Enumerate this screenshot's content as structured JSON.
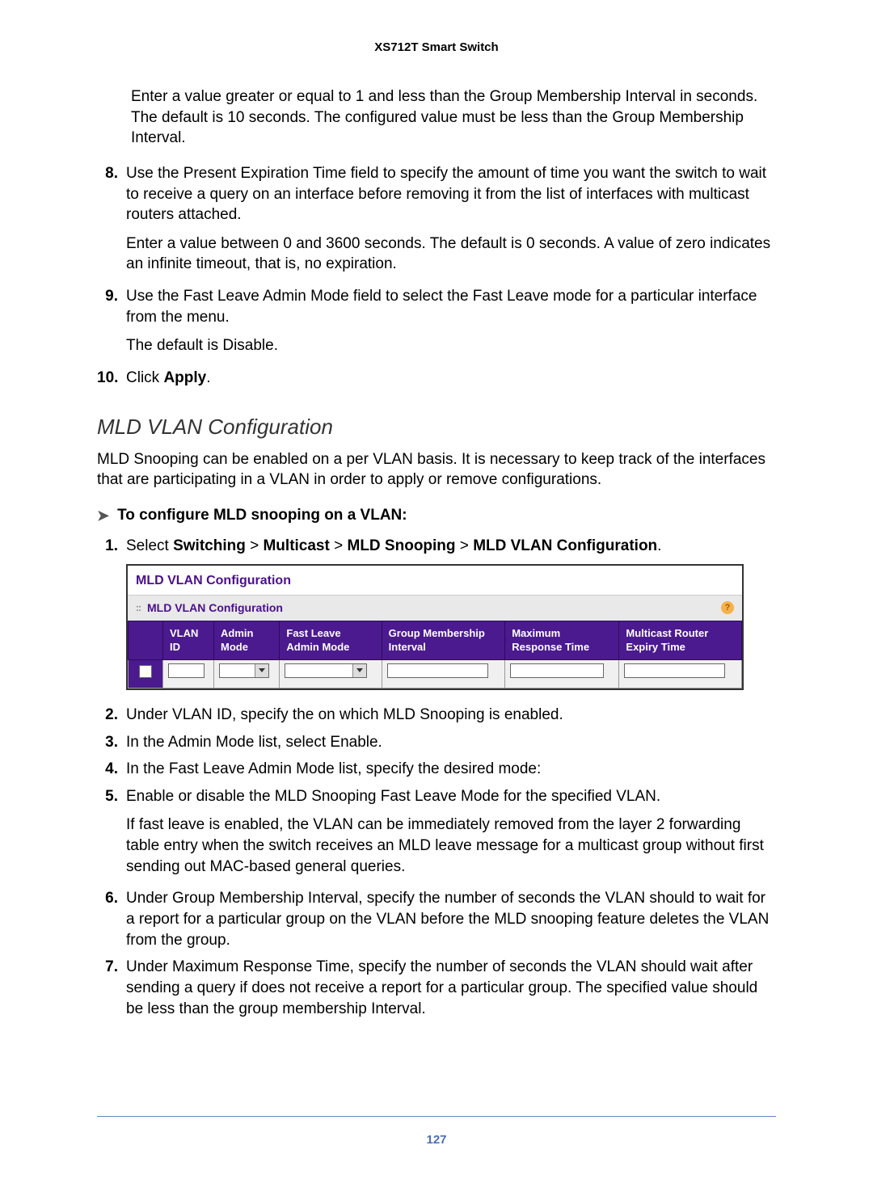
{
  "header": {
    "title": "XS712T Smart Switch"
  },
  "preText": "Enter a value greater or equal to 1 and less than the Group Membership Interval in seconds. The default is 10 seconds. The configured value must be less than the Group Membership Interval.",
  "steps_a": [
    {
      "num": "8.",
      "body": "Use the Present Expiration Time field to specify the amount of time you want the switch to wait to receive a query on an interface before removing it from the list of interfaces with multicast routers attached.",
      "sub": "Enter a value between 0 and 3600 seconds. The default is 0 seconds. A value of zero indicates an infinite timeout, that is, no expiration."
    },
    {
      "num": "9.",
      "body": "Use the Fast Leave Admin Mode field to select the Fast Leave mode for a particular interface from the menu.",
      "sub": "The default is Disable."
    }
  ],
  "step10": {
    "num": "10.",
    "prefix": "Click ",
    "bold": "Apply",
    "suffix": "."
  },
  "section_title": "MLD VLAN Configuration",
  "section_intro": "MLD Snooping can be enabled on a per VLAN basis. It is necessary to keep track of the interfaces that are participating in a VLAN in order to apply or remove configurations.",
  "proc_heading": "To configure MLD snooping on a VLAN:",
  "step1": {
    "num": "1.",
    "prefix": "Select ",
    "bold_parts": [
      "Switching",
      "Multicast",
      "MLD Snooping",
      "MLD VLAN Configuration"
    ],
    "gt": " > ",
    "suffix": "."
  },
  "screenshot": {
    "title": "MLD VLAN Configuration",
    "subtitle": "MLD VLAN Configuration",
    "help": "?",
    "headers": [
      "",
      "VLAN ID",
      "Admin Mode",
      "Fast Leave Admin Mode",
      "Group Membership Interval",
      "Maximum Response Time",
      "Multicast Router Expiry Time"
    ]
  },
  "steps_b": [
    {
      "num": "2.",
      "body": "Under VLAN ID, specify the on which MLD Snooping is enabled."
    },
    {
      "num": "3.",
      "body": "In the Admin Mode list, select Enable."
    },
    {
      "num": "4.",
      "body": "In the Fast Leave Admin Mode list, specify the desired mode:"
    },
    {
      "num": "5.",
      "body": "Enable or disable the MLD Snooping Fast Leave Mode for the specified VLAN.",
      "sub": "If fast leave is enabled, the VLAN can be immediately removed from the layer 2 forwarding table entry when the switch receives an MLD leave message for a multicast group without first sending out MAC-based general queries."
    },
    {
      "num": "6.",
      "body": "Under Group Membership Interval, specify the number of seconds the VLAN should to wait for a report for a particular group on the VLAN before the MLD snooping feature deletes the VLAN from the group."
    },
    {
      "num": "7.",
      "body": "Under Maximum Response Time, specify the number of seconds the VLAN should wait after sending a query if does not receive a report for a particular group. The specified value should be less than the group membership Interval."
    }
  ],
  "footer": {
    "page": "127"
  }
}
